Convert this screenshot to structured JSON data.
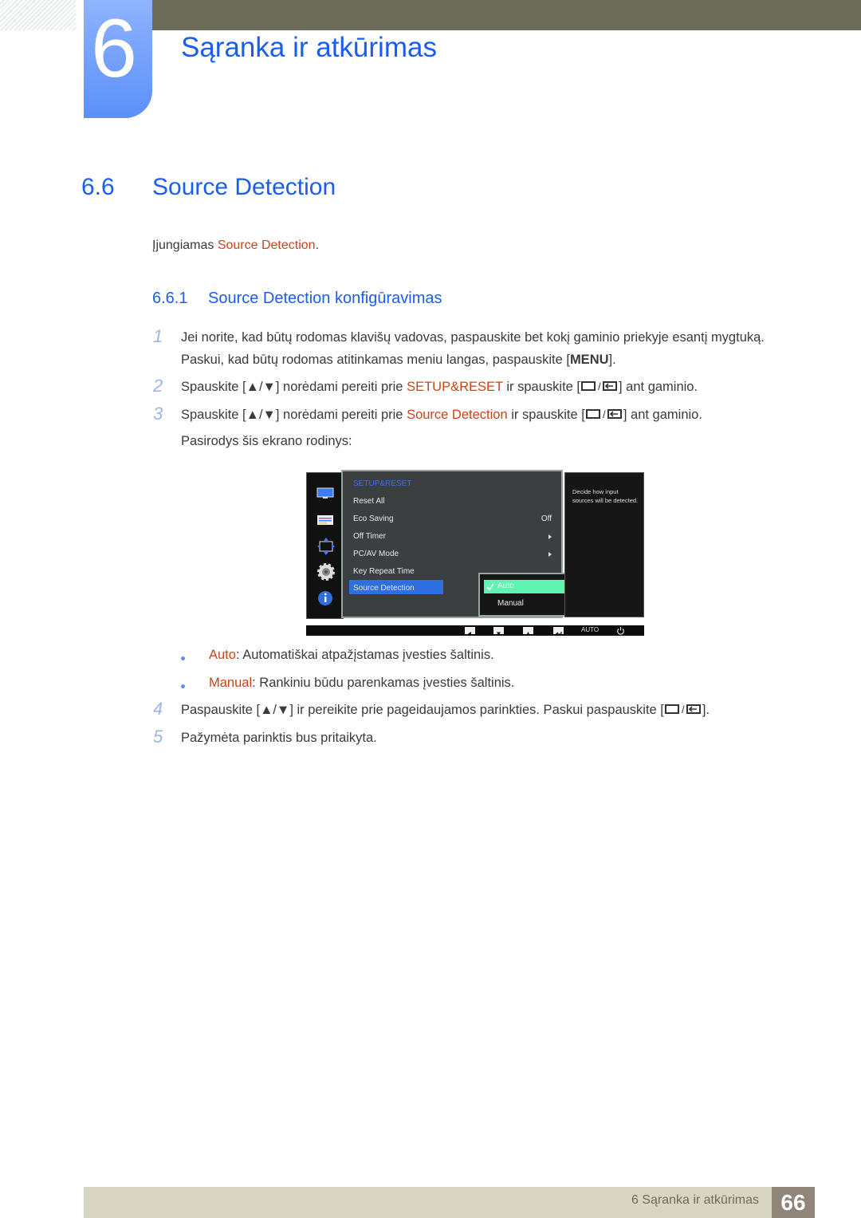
{
  "chapter": {
    "number": "6",
    "title": "Sąranka ir atkūrimas"
  },
  "section": {
    "number": "6.6",
    "title": "Source Detection"
  },
  "intro": {
    "prefix": "Įjungiamas ",
    "highlight": "Source Detection",
    "suffix": "."
  },
  "subsection": {
    "number": "6.6.1",
    "title": "Source Detection konfigūravimas"
  },
  "steps": [
    {
      "no": "1",
      "line1": "Jei norite, kad būtų rodomas klavišų vadovas, paspauskite bet kokį gaminio priekyje esantį mygtuką.",
      "line2_prefix": "Paskui, kad būtų rodomas atitinkamas meniu langas, paspauskite [",
      "line2_key": "MENU",
      "line2_suffix": "]."
    },
    {
      "no": "2",
      "prefix": "Spauskite [",
      "mid1": "] norėdami pereiti prie ",
      "highlight": "SETUP&RESET",
      "mid2": " ir spauskite [",
      "suffix": "] ant gaminio."
    },
    {
      "no": "3",
      "prefix": "Spauskite [",
      "mid1": "] norėdami pereiti prie ",
      "highlight": "Source Detection",
      "mid2": " ir spauskite [",
      "suffix": "] ant gaminio.",
      "line2": "Pasirodys šis ekrano rodinys:"
    },
    {
      "no": "4",
      "prefix": "Paspauskite [",
      "mid1": "] ir pereikite prie pageidaujamos parinkties. Paskui paspauskite [",
      "suffix": "]."
    },
    {
      "no": "5",
      "text": "Pažymėta parinktis bus pritaikyta."
    }
  ],
  "bullets": [
    {
      "term": "Auto",
      "desc": ": Automatiškai atpažįstamas įvesties šaltinis."
    },
    {
      "term": "Manual",
      "desc": ": Rankiniu būdu parenkamas įvesties šaltinis."
    }
  ],
  "osd": {
    "menu_title": "SETUP&RESET",
    "items": [
      {
        "label": "Reset All",
        "value": "",
        "arrow": false
      },
      {
        "label": "Eco Saving",
        "value": "Off",
        "arrow": false
      },
      {
        "label": "Off Timer",
        "value": "",
        "arrow": true
      },
      {
        "label": "PC/AV Mode",
        "value": "",
        "arrow": true
      },
      {
        "label": "Key Repeat Time",
        "value": "",
        "arrow": false
      },
      {
        "label": "Source Detection",
        "value": "",
        "arrow": false,
        "selected": true
      }
    ],
    "submenu": [
      {
        "label": "Auto",
        "checked": true
      },
      {
        "label": "Manual",
        "checked": false
      }
    ],
    "help_text": "Decide how input sources will be detected.",
    "side_icons": [
      "monitor-icon",
      "color-bars-icon",
      "size-position-icon",
      "gear-icon",
      "info-icon"
    ],
    "bottom_buttons": [
      "left-icon",
      "down-icon",
      "up-icon",
      "enter-icon",
      "AUTO",
      "power-icon"
    ],
    "auto_label": "AUTO"
  },
  "footer": {
    "text": "6 Sąranka ir atkūrimas",
    "page": "66"
  },
  "colors": {
    "accent_blue": "#1a5df0",
    "highlight_orange": "#c8441a",
    "topbar": "#6d6c58",
    "footer_bg": "#d9d5c3",
    "page_box": "#8f8578"
  }
}
